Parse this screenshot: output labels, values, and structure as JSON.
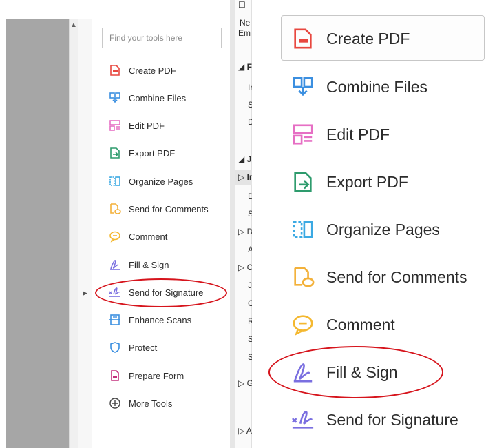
{
  "search": {
    "placeholder": "Find your tools here"
  },
  "tools": [
    {
      "label": "Create PDF",
      "icon": "create-pdf-icon"
    },
    {
      "label": "Combine Files",
      "icon": "combine-files-icon"
    },
    {
      "label": "Edit PDF",
      "icon": "edit-pdf-icon"
    },
    {
      "label": "Export PDF",
      "icon": "export-pdf-icon"
    },
    {
      "label": "Organize Pages",
      "icon": "organize-pages-icon"
    },
    {
      "label": "Send for Comments",
      "icon": "send-for-comments-icon"
    },
    {
      "label": "Comment",
      "icon": "comment-icon"
    },
    {
      "label": "Fill & Sign",
      "icon": "fill-sign-icon"
    },
    {
      "label": "Send for Signature",
      "icon": "send-for-signature-icon"
    },
    {
      "label": "Enhance Scans",
      "icon": "enhance-scans-icon"
    },
    {
      "label": "Protect",
      "icon": "protect-icon"
    },
    {
      "label": "Prepare Form",
      "icon": "prepare-form-icon"
    },
    {
      "label": "More Tools",
      "icon": "more-tools-icon"
    }
  ],
  "middle_column": {
    "header_line1": "Ne",
    "header_line2": "Em",
    "items": [
      "◢ F",
      "Ir",
      "S",
      "D",
      "◢ J",
      "▷ Ir",
      "D",
      "S",
      "▷ D",
      "A",
      "▷ C",
      "Ju",
      "C",
      "R",
      "S",
      "S",
      "▷ G",
      "▷ A"
    ]
  },
  "zoom": {
    "tools": [
      {
        "label": "Create PDF"
      },
      {
        "label": "Combine Files"
      },
      {
        "label": "Edit PDF"
      },
      {
        "label": "Export PDF"
      },
      {
        "label": "Organize Pages"
      },
      {
        "label": "Send for Comments"
      },
      {
        "label": "Comment"
      },
      {
        "label": "Fill & Sign"
      },
      {
        "label": "Send for Signature"
      }
    ]
  },
  "colors": {
    "create_pdf": "#e8473f",
    "combine_files": "#3b8fe0",
    "edit_pdf": "#e66fc4",
    "export_pdf": "#2e9b6d",
    "organize_pages": "#3ba9e3",
    "send_for_comments": "#f3b13a",
    "comment": "#f4b830",
    "fill_sign": "#7a6fe0",
    "send_for_signature": "#7a6fe0",
    "enhance_scans": "#3b8fe0",
    "protect": "#3b8fe0",
    "prepare_form": "#c4307e",
    "more_tools": "#444444",
    "annotation_red": "#d6141c"
  }
}
